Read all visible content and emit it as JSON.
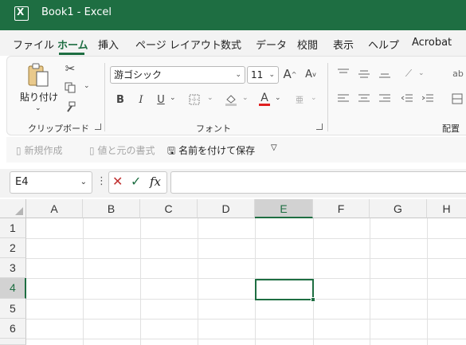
{
  "window": {
    "title": "Book1  -  Excel",
    "app_icon": "excel-logo-icon",
    "logo_letter": "X"
  },
  "menu": {
    "tabs": [
      "ファイル",
      "ホーム",
      "挿入",
      "ページ レイアウト",
      "数式",
      "データ",
      "校閲",
      "表示",
      "ヘルプ",
      "Acrobat"
    ],
    "active": "ホーム"
  },
  "ribbon": {
    "clipboard": {
      "paste_label": "貼り付け",
      "group_label": "クリップボード"
    },
    "font": {
      "font_name": "游ゴシック",
      "font_size": "11",
      "group_label": "フォント",
      "bold": "B",
      "italic": "I",
      "underline": "U",
      "grow": "A",
      "shrink": "A",
      "font_color": "A"
    },
    "alignment": {
      "group_label": "配置"
    }
  },
  "quick_access": {
    "new": "新規作成",
    "paste_values": "値と元の書式",
    "save_as": "名前を付けて保存"
  },
  "formula_bar": {
    "name_box": "E4",
    "fx": "fx",
    "formula": ""
  },
  "grid": {
    "columns": [
      "A",
      "B",
      "C",
      "D",
      "E",
      "F",
      "G",
      "H"
    ],
    "rows": [
      "1",
      "2",
      "3",
      "4",
      "5",
      "6"
    ],
    "active_cell": "E4",
    "accent": "#1e6e42"
  }
}
